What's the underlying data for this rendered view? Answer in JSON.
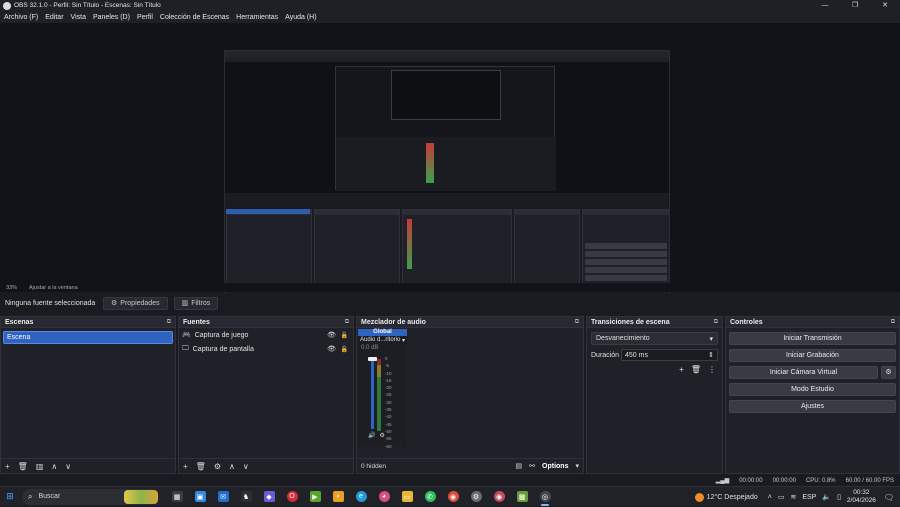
{
  "window": {
    "title": "OBS 32.1.0 - Perfil: Sin Título - Escenas: Sin Título",
    "minimize": "—",
    "restore": "❐",
    "close": "✕"
  },
  "menu": [
    "Archivo (F)",
    "Editar",
    "Vista",
    "Paneles (D)",
    "Perfil",
    "Colección de Escenas",
    "Herramientas",
    "Ayuda (H)"
  ],
  "zoom": {
    "level": "33%",
    "fit": "Ajustar a la ventana"
  },
  "source_bar": {
    "no_source": "Ninguna fuente seleccionada",
    "properties": "Propiedades",
    "filters": "Filtros"
  },
  "scenes": {
    "title": "Escenas",
    "items": [
      "Escena"
    ]
  },
  "sources": {
    "title": "Fuentes",
    "items": [
      {
        "icon": "gamepad-icon",
        "label": "Captura de juego"
      },
      {
        "icon": "monitor-icon",
        "label": "Captura de pantalla"
      }
    ]
  },
  "mixer": {
    "title": "Mezclador de audio",
    "global": "Global",
    "channel": "Audio d...ritorio",
    "db": "0.0 dB",
    "scale": [
      "0",
      "-5",
      "-10",
      "-15",
      "-20",
      "-25",
      "-30",
      "-35",
      "-40",
      "-45",
      "-50",
      "-55",
      "-60"
    ],
    "hidden": "0 hidden",
    "options": "Options"
  },
  "transitions": {
    "title": "Transiciones de escena",
    "selected": "Desvanecimiento",
    "duration_label": "Duración",
    "duration_value": "450 ms"
  },
  "controls": {
    "title": "Controles",
    "start_stream": "Iniciar Transmisión",
    "start_record": "Iniciar Grabación",
    "virtual_cam": "Iniciar Cámara Virtual",
    "studio_mode": "Modo Estudio",
    "settings": "Ajustes"
  },
  "status": {
    "rec_time": "00:00:00",
    "stream_time": "00:00:00",
    "cpu": "CPU: 0.8%",
    "fps": "60.00 / 60.00 FPS"
  },
  "taskbar": {
    "search": "Buscar",
    "weather": "12°C  Despejado",
    "lang": "ESP",
    "time": "00:32",
    "date": "2/04/2026"
  },
  "colors": {
    "accent": "#2f63c1",
    "panel": "#202128",
    "button": "#393a44"
  }
}
